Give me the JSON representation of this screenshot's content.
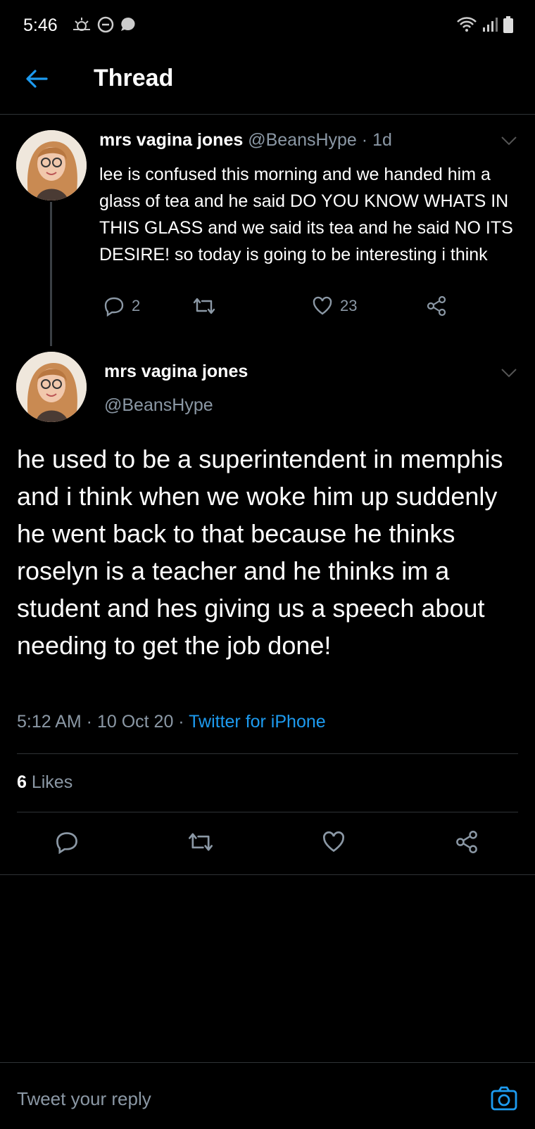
{
  "status_bar": {
    "time": "5:46",
    "left_icons": [
      "weather-icon",
      "dnd-icon",
      "chat-bubble-icon"
    ],
    "right_icons": [
      "wifi-icon",
      "signal-icon",
      "battery-icon"
    ]
  },
  "header": {
    "title": "Thread"
  },
  "parent_tweet": {
    "name": "mrs vagina jones",
    "handle": "@BeansHype",
    "separator": " · ",
    "age": "1d",
    "text": "lee is confused this morning and we handed him a glass of tea and he said DO YOU KNOW WHATS IN THIS GLASS and we said its tea and he said NO ITS DESIRE! so today is going to be interesting i think",
    "replies": "2",
    "likes": "23"
  },
  "main_tweet": {
    "name": "mrs vagina jones",
    "handle": "@BeansHype",
    "text": "he used to be a superintendent in memphis and i think when we woke him up suddenly he went back to that because he thinks roselyn is a teacher and he thinks im a student and hes giving us a speech about needing to get the job done!",
    "time": "5:12 AM",
    "date": "10 Oct 20",
    "source": "Twitter for iPhone",
    "dot": " · ",
    "likes_count": "6",
    "likes_label": " Likes"
  },
  "reply": {
    "placeholder": "Tweet your reply"
  },
  "colors": {
    "background": "#000000",
    "accent": "#1d9bf0",
    "muted": "#8b98a5"
  }
}
